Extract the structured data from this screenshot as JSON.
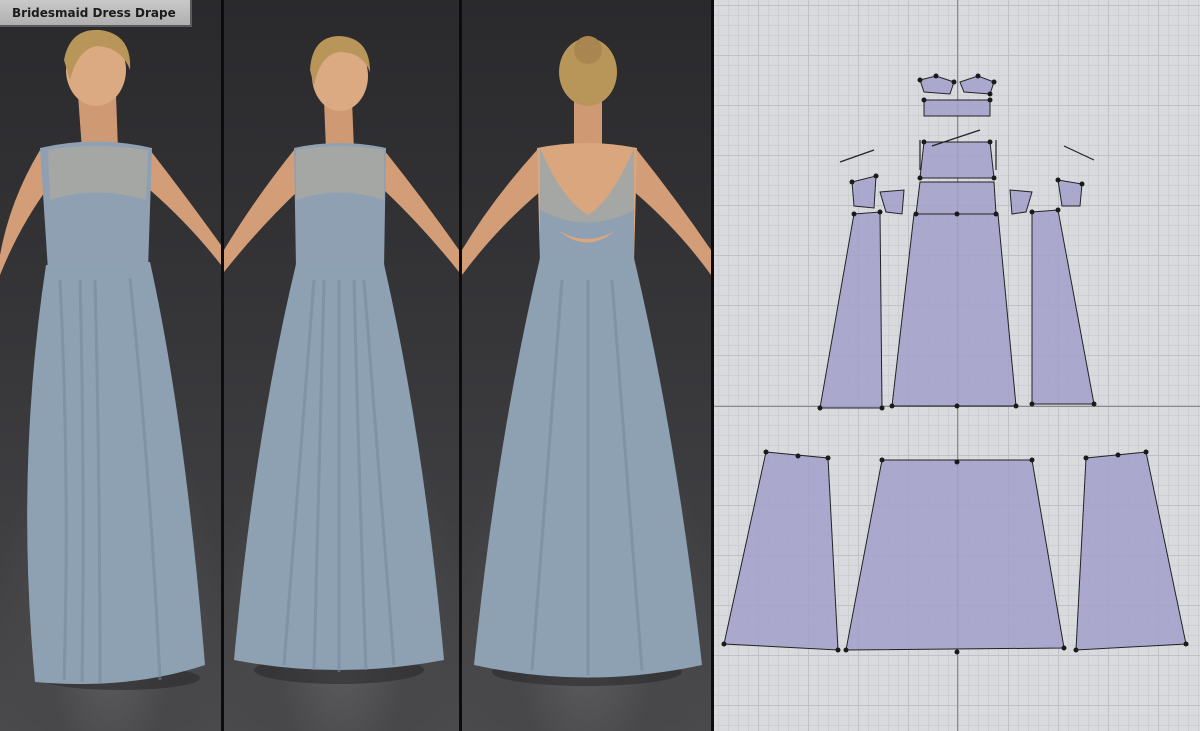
{
  "window": {
    "title": "Bridesmaid Dress Drape"
  },
  "colors": {
    "fabric": "#8fa2b4",
    "fabric_shadow": "#6d8093",
    "mesh_yoke": "#a7aaa6",
    "skin": "#d9a67e",
    "hair": "#b5935a",
    "pattern_piece": "#a29fcb",
    "pattern_grid": "#d9dadd"
  },
  "views": {
    "front_three_quarter": {
      "label": "avatar-front-three-quarter-view"
    },
    "front": {
      "label": "avatar-front-view"
    },
    "back": {
      "label": "avatar-back-view"
    }
  }
}
